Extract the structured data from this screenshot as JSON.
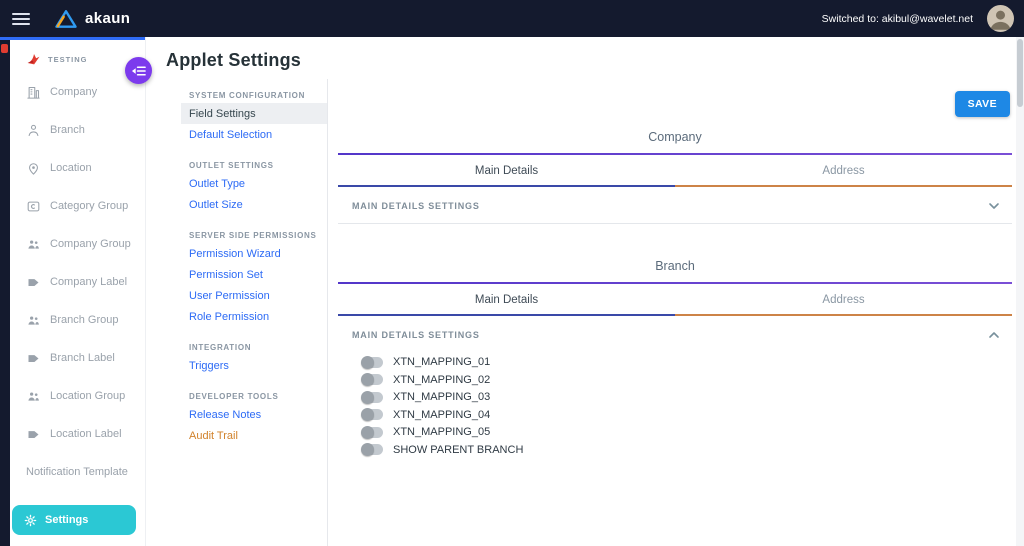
{
  "topbar": {
    "brand": "akaun",
    "switched_label": "Switched to: akibul@wavelet.net"
  },
  "sidebar": {
    "applet_label": "TESTING",
    "items": [
      {
        "label": "Company",
        "icon": "building-icon"
      },
      {
        "label": "Branch",
        "icon": "person-icon"
      },
      {
        "label": "Location",
        "icon": "map-pin-icon"
      },
      {
        "label": "Category Group",
        "icon": "card-icon"
      },
      {
        "label": "Company Group",
        "icon": "people-icon"
      },
      {
        "label": "Company Label",
        "icon": "tag-icon"
      },
      {
        "label": "Branch Group",
        "icon": "people-icon"
      },
      {
        "label": "Branch Label",
        "icon": "tag-icon"
      },
      {
        "label": "Location Group",
        "icon": "people-icon"
      },
      {
        "label": "Location Label",
        "icon": "tag-icon"
      },
      {
        "label": "Notification Template",
        "icon": ""
      }
    ],
    "settings_label": "Settings"
  },
  "page": {
    "title": "Applet Settings"
  },
  "settings_nav": {
    "sections": [
      {
        "heading": "SYSTEM CONFIGURATION",
        "items": [
          {
            "label": "Field Settings",
            "active": true
          },
          {
            "label": "Default Selection",
            "active": false
          }
        ]
      },
      {
        "heading": "OUTLET SETTINGS",
        "items": [
          {
            "label": "Outlet Type"
          },
          {
            "label": "Outlet Size"
          }
        ]
      },
      {
        "heading": "SERVER SIDE PERMISSIONS",
        "items": [
          {
            "label": "Permission Wizard"
          },
          {
            "label": "Permission Set"
          },
          {
            "label": "User Permission"
          },
          {
            "label": "Role Permission"
          }
        ]
      },
      {
        "heading": "INTEGRATION",
        "items": [
          {
            "label": "Triggers"
          }
        ]
      },
      {
        "heading": "DEVELOPER TOOLS",
        "items": [
          {
            "label": "Release Notes"
          },
          {
            "label": "Audit Trail"
          }
        ]
      }
    ]
  },
  "content": {
    "save_label": "SAVE",
    "company": {
      "title": "Company",
      "tab_main": "Main Details",
      "tab_address": "Address",
      "panel_heading": "MAIN DETAILS SETTINGS",
      "collapsed": true
    },
    "branch": {
      "title": "Branch",
      "tab_main": "Main Details",
      "tab_address": "Address",
      "panel_heading": "MAIN DETAILS SETTINGS",
      "collapsed": false,
      "toggles": [
        {
          "label": "XTN_MAPPING_01",
          "state": "off"
        },
        {
          "label": "XTN_MAPPING_02",
          "state": "off"
        },
        {
          "label": "XTN_MAPPING_03",
          "state": "off"
        },
        {
          "label": "XTN_MAPPING_04",
          "state": "off"
        },
        {
          "label": "XTN_MAPPING_05",
          "state": "off"
        },
        {
          "label": "SHOW PARENT BRANCH",
          "state": "off"
        }
      ]
    }
  },
  "colors": {
    "topbar_bg": "#141a2e",
    "accent_cyan": "#2bc8d4",
    "link_blue": "#2d6bf5",
    "save_blue": "#1e88e5",
    "purple_line": "#5f3ed0",
    "tab_active_line": "#3a49a8",
    "tab_inactive_line": "#cd8347",
    "fab_purple": "#7c3aed",
    "audit_trail_amber": "#d1822b",
    "loading_bar_blue": "#2f6cf6"
  }
}
